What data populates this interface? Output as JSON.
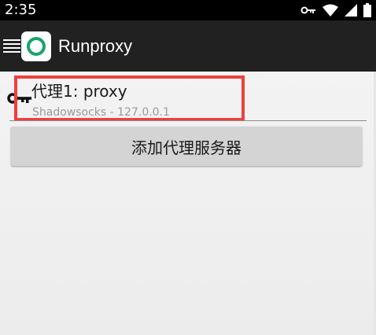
{
  "status_bar": {
    "time": "2:35",
    "icons": [
      "key-icon",
      "wifi-icon",
      "signal-icon",
      "battery-icon"
    ]
  },
  "app_bar": {
    "title": "Runproxy",
    "logo_colors": {
      "ring": "#1aa36a",
      "background": "#ffffff"
    },
    "background": "#212121"
  },
  "proxy_list": {
    "items": [
      {
        "name": "代理1: proxy",
        "detail": "Shadowsocks - 127.0.0.1",
        "icon": "key-icon"
      }
    ],
    "highlight_color": "#f23d3d"
  },
  "actions": {
    "add_proxy_label": "添加代理服务器"
  }
}
